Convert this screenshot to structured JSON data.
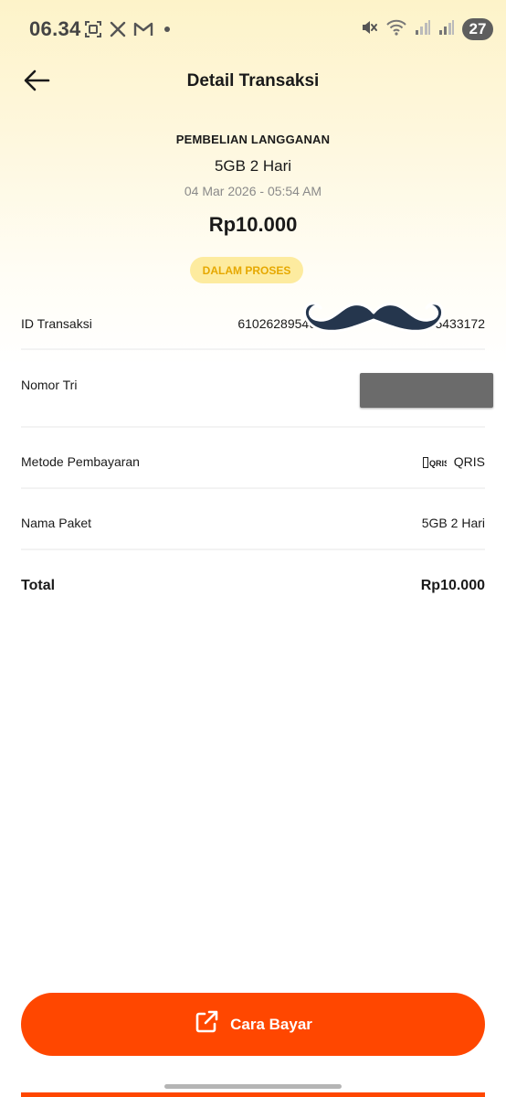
{
  "status_bar": {
    "time": "06.34",
    "battery_level": "27",
    "left_icons": [
      "screenshot-icon",
      "x-app-icon",
      "gmail-icon",
      "notification-dot-icon"
    ],
    "right_icons": [
      "mute-icon",
      "wifi-icon",
      "signal-icon",
      "signal-icon-2"
    ]
  },
  "header": {
    "title": "Detail Transaksi",
    "back_icon": "arrow-left-icon"
  },
  "summary": {
    "purchase_type": "PEMBELIAN LANGGANAN",
    "package": "5GB 2 Hari",
    "date": "04 Mar 2026 - 05:54 AM",
    "amount": "Rp10.000",
    "status": "DALAM PROSES"
  },
  "details": {
    "rows": [
      {
        "label": "ID Transaksi",
        "value": "61026289546",
        "value_end": "85433172"
      },
      {
        "label": "Nomor Tri",
        "value": ""
      },
      {
        "label": "Metode Pembayaran",
        "value": "QRIS",
        "logo_text": "QRIS"
      },
      {
        "label": "Nama Paket",
        "value": "5GB 2 Hari"
      }
    ],
    "total_label": "Total",
    "total_value": "Rp10.000"
  },
  "pay_button": {
    "label": "Cara Bayar",
    "icon": "external-link-icon"
  },
  "colors": {
    "accent": "#ff4700",
    "badge_bg": "#fdeb9f",
    "badge_text": "#e6a800",
    "header_bg": "#fdf3c9"
  }
}
